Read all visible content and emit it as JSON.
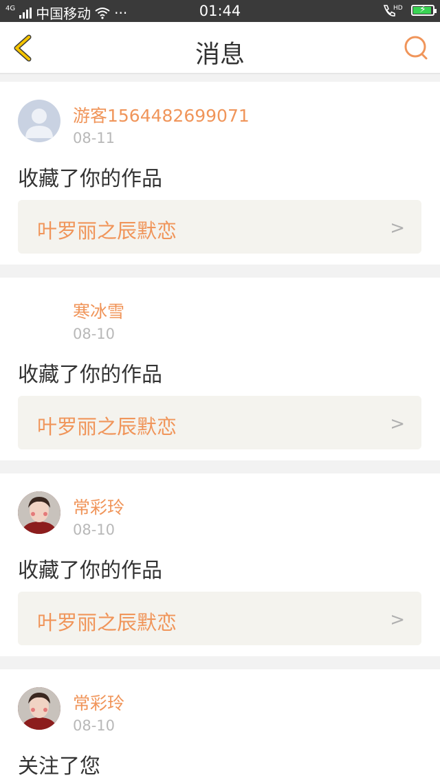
{
  "status_bar": {
    "network": "4G",
    "carrier": "中国移动",
    "more": "···",
    "time": "01:44",
    "hd": "HD"
  },
  "header": {
    "title": "消息"
  },
  "messages": [
    {
      "user": "游客1564482699071",
      "date": "08-11",
      "action": "收藏了你的作品",
      "work": "叶罗丽之辰默恋"
    },
    {
      "user": "寒冰雪",
      "date": "08-10",
      "action": "收藏了你的作品",
      "work": "叶罗丽之辰默恋"
    },
    {
      "user": "常彩玲",
      "date": "08-10",
      "action": "收藏了你的作品",
      "work": "叶罗丽之辰默恋"
    },
    {
      "user": "常彩玲",
      "date": "08-10",
      "action": "关注了您"
    }
  ],
  "colors": {
    "accent": "#f0955a",
    "back_arrow": "#f5c400"
  }
}
